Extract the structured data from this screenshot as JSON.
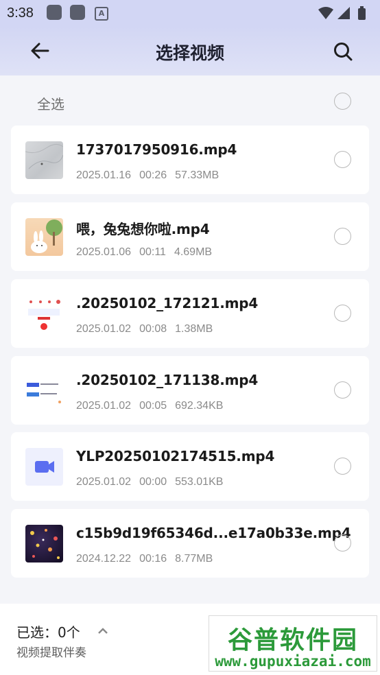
{
  "status_bar": {
    "time": "3:38",
    "icons": [
      "app-icon",
      "app-icon",
      "a-icon",
      "wifi-icon",
      "signal-icon",
      "battery-icon"
    ],
    "a_glyph": "A"
  },
  "header": {
    "title": "选择视频"
  },
  "select_all": {
    "label": "全选"
  },
  "files": [
    {
      "name": "1737017950916.mp4",
      "date": "2025.01.16",
      "duration": "00:26",
      "size": "57.33MB",
      "thumb": "gray-texture"
    },
    {
      "name": "喂，兔兔想你啦.mp4",
      "date": "2025.01.06",
      "duration": "00:11",
      "size": "4.69MB",
      "thumb": "bunny-illustration"
    },
    {
      "name": ".20250102_172121.mp4",
      "date": "2025.01.02",
      "duration": "00:08",
      "size": "1.38MB",
      "thumb": "app-screenshot"
    },
    {
      "name": ".20250102_171138.mp4",
      "date": "2025.01.02",
      "duration": "00:05",
      "size": "692.34KB",
      "thumb": "app-screenshot-blue"
    },
    {
      "name": "YLP20250102174515.mp4",
      "date": "2025.01.02",
      "duration": "00:00",
      "size": "553.01KB",
      "thumb": "video-camera-icon"
    },
    {
      "name": "c15b9d19f65346d...e17a0b33e.mp4",
      "date": "2024.12.22",
      "duration": "00:16",
      "size": "8.77MB",
      "thumb": "night-flowers"
    }
  ],
  "bottom": {
    "selected": "已选：0个",
    "subtitle": "视频提取伴奏"
  },
  "watermark": {
    "main": "谷普软件园",
    "url": "www.gupuxiazai.com"
  },
  "colors": {
    "header_bg": "#d2d6f4",
    "page_bg": "#f4f5f9",
    "accent": "#5b6ef0",
    "watermark": "#2c9a3a"
  }
}
